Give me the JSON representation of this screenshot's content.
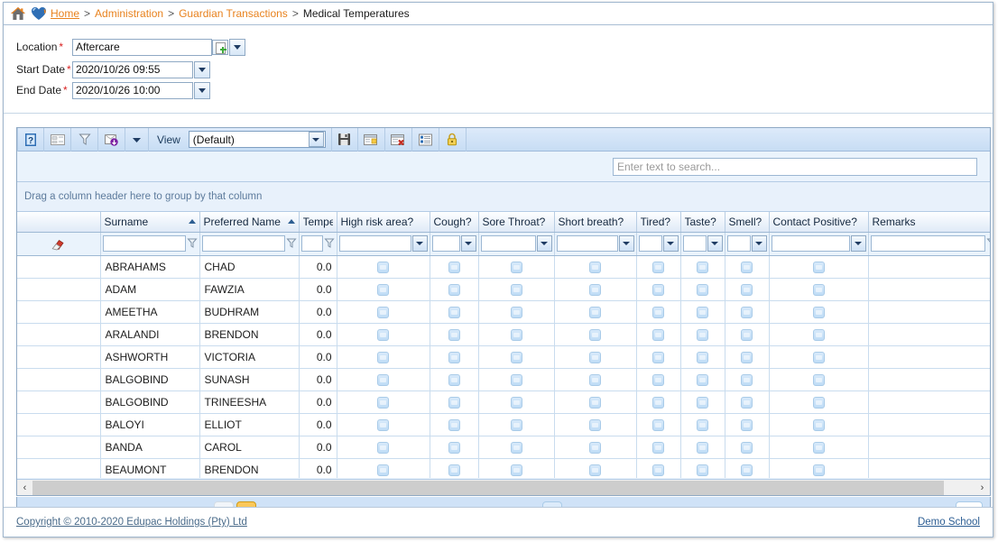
{
  "breadcrumb": {
    "items": [
      {
        "label": "Home",
        "type": "link"
      },
      {
        "label": "Administration",
        "type": "link"
      },
      {
        "label": "Guardian Transactions",
        "type": "link"
      },
      {
        "label": "Medical Temperatures",
        "type": "current"
      }
    ],
    "separator": ">"
  },
  "criteria": {
    "location": {
      "label": "Location",
      "required": "*",
      "value": "Aftercare"
    },
    "start_date": {
      "label": "Start Date",
      "required": "*",
      "value": "2020/10/26 09:55"
    },
    "end_date": {
      "label": "End Date",
      "required": "*",
      "value": "2020/10/26 10:00"
    }
  },
  "toolbar": {
    "view_label": "View",
    "view_value": "(Default)",
    "buttons": [
      {
        "name": "help-icon"
      },
      {
        "name": "layout-icon"
      },
      {
        "name": "filter-icon"
      },
      {
        "name": "export-icon"
      },
      {
        "name": "chevron-down-icon"
      }
    ],
    "right_buttons": [
      {
        "name": "save-icon"
      },
      {
        "name": "new-view-icon"
      },
      {
        "name": "delete-view-icon"
      },
      {
        "name": "columns-icon"
      },
      {
        "name": "lock-icon"
      }
    ]
  },
  "search": {
    "placeholder": "Enter text to search...",
    "value": ""
  },
  "group_panel": {
    "hint": "Drag a column header here to group by that column"
  },
  "grid": {
    "columns": [
      {
        "key": "rowind",
        "label": "",
        "width": 92,
        "sorted": "",
        "filter": "none"
      },
      {
        "key": "surname",
        "label": "Surname",
        "width": 110,
        "sorted": "asc",
        "filter": "text"
      },
      {
        "key": "preferred",
        "label": "Preferred Name",
        "width": 110,
        "sorted": "asc",
        "filter": "text"
      },
      {
        "key": "temp",
        "label": "Tempera",
        "width": 42,
        "sorted": "",
        "filter": "text"
      },
      {
        "key": "highrisk",
        "label": "High risk area?",
        "width": 103,
        "sorted": "",
        "filter": "dropdown"
      },
      {
        "key": "cough",
        "label": "Cough?",
        "width": 54,
        "sorted": "",
        "filter": "dropdown"
      },
      {
        "key": "sore",
        "label": "Sore Throat?",
        "width": 84,
        "sorted": "",
        "filter": "dropdown"
      },
      {
        "key": "breath",
        "label": "Short breath?",
        "width": 91,
        "sorted": "",
        "filter": "dropdown"
      },
      {
        "key": "tired",
        "label": "Tired?",
        "width": 49,
        "sorted": "",
        "filter": "dropdown"
      },
      {
        "key": "taste",
        "label": "Taste?",
        "width": 49,
        "sorted": "",
        "filter": "dropdown"
      },
      {
        "key": "smell",
        "label": "Smell?",
        "width": 49,
        "sorted": "",
        "filter": "dropdown"
      },
      {
        "key": "contact",
        "label": "Contact Positive?",
        "width": 110,
        "sorted": "",
        "filter": "dropdown"
      },
      {
        "key": "remarks",
        "label": "Remarks",
        "width": 145,
        "sorted": "",
        "filter": "text"
      }
    ],
    "rows": [
      {
        "surname": "ABRAHAMS",
        "preferred": "CHAD",
        "temp": "0.0",
        "highrisk": false,
        "cough": false,
        "sore": false,
        "breath": false,
        "tired": false,
        "taste": false,
        "smell": false,
        "contact": false,
        "remarks": ""
      },
      {
        "surname": "ADAM",
        "preferred": "FAWZIA",
        "temp": "0.0",
        "highrisk": false,
        "cough": false,
        "sore": false,
        "breath": false,
        "tired": false,
        "taste": false,
        "smell": false,
        "contact": false,
        "remarks": ""
      },
      {
        "surname": "AMEETHA",
        "preferred": "BUDHRAM",
        "temp": "0.0",
        "highrisk": false,
        "cough": false,
        "sore": false,
        "breath": false,
        "tired": false,
        "taste": false,
        "smell": false,
        "contact": false,
        "remarks": ""
      },
      {
        "surname": "ARALANDI",
        "preferred": "BRENDON",
        "temp": "0.0",
        "highrisk": false,
        "cough": false,
        "sore": false,
        "breath": false,
        "tired": false,
        "taste": false,
        "smell": false,
        "contact": false,
        "remarks": ""
      },
      {
        "surname": "ASHWORTH",
        "preferred": "VICTORIA",
        "temp": "0.0",
        "highrisk": false,
        "cough": false,
        "sore": false,
        "breath": false,
        "tired": false,
        "taste": false,
        "smell": false,
        "contact": false,
        "remarks": ""
      },
      {
        "surname": "BALGOBIND",
        "preferred": "SUNASH",
        "temp": "0.0",
        "highrisk": false,
        "cough": false,
        "sore": false,
        "breath": false,
        "tired": false,
        "taste": false,
        "smell": false,
        "contact": false,
        "remarks": ""
      },
      {
        "surname": "BALGOBIND",
        "preferred": "TRINEESHA",
        "temp": "0.0",
        "highrisk": false,
        "cough": false,
        "sore": false,
        "breath": false,
        "tired": false,
        "taste": false,
        "smell": false,
        "contact": false,
        "remarks": ""
      },
      {
        "surname": "BALOYI",
        "preferred": "ELLIOT",
        "temp": "0.0",
        "highrisk": false,
        "cough": false,
        "sore": false,
        "breath": false,
        "tired": false,
        "taste": false,
        "smell": false,
        "contact": false,
        "remarks": ""
      },
      {
        "surname": "BANDA",
        "preferred": "CAROL",
        "temp": "0.0",
        "highrisk": false,
        "cough": false,
        "sore": false,
        "breath": false,
        "tired": false,
        "taste": false,
        "smell": false,
        "contact": false,
        "remarks": ""
      },
      {
        "surname": "BEAUMONT",
        "preferred": "BRENDON",
        "temp": "0.0",
        "highrisk": false,
        "cough": false,
        "sore": false,
        "breath": false,
        "tired": false,
        "taste": false,
        "smell": false,
        "contact": false,
        "remarks": ""
      }
    ]
  },
  "scrollbar": {
    "left_arrow": "‹",
    "right_arrow": "›"
  },
  "footer": {
    "copyright": "Copyright © 2010-2020 Edupac Holdings (Pty) Ltd",
    "tenant": "Demo School"
  },
  "colors": {
    "accent_orange": "#E8821E",
    "link_blue": "#2c5d93",
    "required_red": "#d92121",
    "header_blue": "#dfeaf7",
    "panel_blue": "#eaf3fc"
  }
}
